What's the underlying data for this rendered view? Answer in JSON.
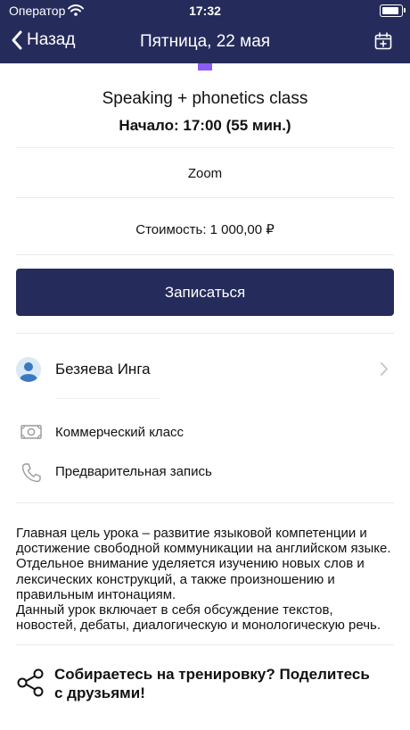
{
  "status_bar": {
    "carrier": "Оператор",
    "time": "17:32"
  },
  "nav": {
    "back_label": "Назад",
    "title": "Пятница, 22 мая"
  },
  "lesson": {
    "title": "Speaking + phonetics class",
    "start": "Начало: 17:00 (55 мин.)",
    "platform": "Zoom",
    "price": "Стоимость: 1 000,00 ₽"
  },
  "signup_button": "Записаться",
  "trainer": {
    "name": "Безяева Инга"
  },
  "info": {
    "class_type": "Коммерческий класс",
    "booking": "Предварительная запись"
  },
  "description": {
    "paragraph1": "Главная цель урока – развитие языковой компетенции и достижение свободной коммуникации на английском языке. Отдельное внимание уделяется изучению новых слов и лексических конструкций, а также произношению и правильным интонациям.",
    "paragraph2": "Данный урок включает в себя обсуждение текстов, новостей, дебаты, диалогическую и монологическую речь."
  },
  "share": {
    "line1": "Собираетесь на тренировку? Поделитесь",
    "line2": "с друзьями!"
  },
  "colors": {
    "header_bg": "#252c5b",
    "accent": "#8b5cf6",
    "button_bg": "#252c5b"
  }
}
